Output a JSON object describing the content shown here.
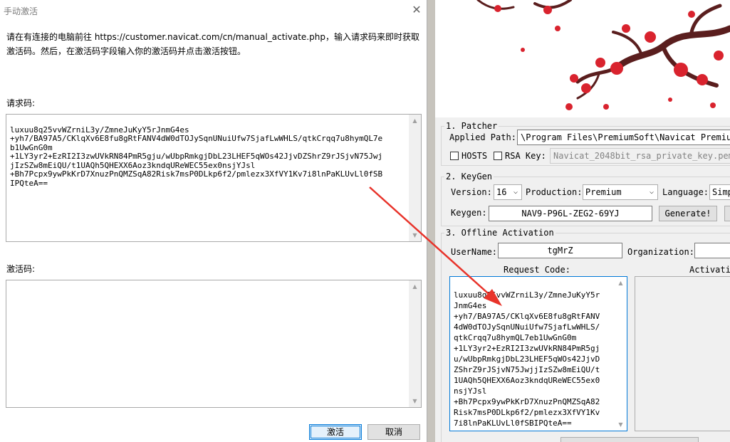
{
  "dialog": {
    "title": "手动激活",
    "instruction": "请在有连接的电脑前往 https://customer.navicat.com/cn/manual_activate.php，输入请求码来即时获取激活码。然后，在激活码字段输入你的激活码并点击激活按钮。",
    "request_label": "请求码:",
    "request_lines": [
      "luxuu8q25vvWZrniL3y/ZmneJuKyY5rJnmG4es",
      "+yh7/BA97A5/CKlqXv6E8fu8gRtFANV4dW0dTOJySqnUNuiUfw7SjafLwWHLS/qtkCrqq7u8hymQL7e",
      "b1UwGnG0m",
      "+1LY3yr2+EzRI2I3zwUVkRN84PmR5gju/wUbpRmkgjDbL23LHEF5qWOs42JjvDZShrZ9rJSjvN75Jwj",
      "jIzSZw8mEiQU/t1UAQh5QHEXX6Aoz3kndqUReWEC55ex0nsjYJsl",
      "+Bh7Pcpx9ywPkKrD7XnuzPnQMZSqA82Risk7msP0DLkp6f2/pmlezx3XfVY1Kv7i8lnPaKLUvLl0fSB",
      "IPQteA=="
    ],
    "activation_label": "激活码:",
    "activate_button": "激活",
    "cancel_button": "取消",
    "close_glyph": "✕"
  },
  "keygen": {
    "patcher": {
      "legend": "1. Patcher",
      "applied_path_label": "Applied Path:",
      "applied_path_value": "\\Program Files\\PremiumSoft\\Navicat Premium",
      "hosts_label": "HOSTS",
      "rsa_key_label": "RSA Key:",
      "rsa_key_value": "Navicat_2048bit_rsa_private_key.pem"
    },
    "keygen_section": {
      "legend": "2. KeyGen",
      "version_label": "Version:",
      "version_value": "16",
      "production_label": "Production:",
      "production_value": "Premium",
      "language_label": "Language:",
      "language_value": "Simp",
      "keygen_label": "Keygen:",
      "keygen_value": "NAV9-P96L-ZEG2-69YJ",
      "generate_button": "Generate!"
    },
    "offline": {
      "legend": "3. Offline Activation",
      "username_label": "UserName:",
      "username_value": "tgMrZ",
      "organization_label": "Organization:",
      "request_code_label": "Request Code:",
      "activation_label": "Activatio",
      "request_lines": [
        "luxuu8q25vvWZrniL3y/ZmneJuKyY5r",
        "JnmG4es",
        "+yh7/BA97A5/CKlqXv6E8fu8gRtFANV",
        "4dW0dTOJySqnUNuiUfw7SjafLwWHLS/",
        "qtkCrqq7u8hymQL7eb1UwGnG0m",
        "+1LY3yr2+EzRI2I3zwUVkRN84PmR5gj",
        "u/wUbpRmkgjDbL23LHEF5qWOs42JjvD",
        "ZShrZ9rJSjvN75JwjjIzSZw8mEiQU/t",
        "1UAQh5QHEXX6Aoz3kndqUReWEC55ex0",
        "nsjYJsl",
        "+Bh7Pcpx9ywPkKrD7XnuzPnQMZSqA82",
        "Risk7msP0DLkp6f2/pmlezx3XfVY1Kv",
        "7i8lnPaKLUvLl0fSBIPQteA=="
      ]
    }
  },
  "colors": {
    "accent": "#0078d7",
    "annotation_arrow": "#e8332a",
    "branch": "#5a1e1e",
    "blossom": "#d9232e"
  },
  "glyphs": {
    "arrow_up": "▲",
    "arrow_down": "▼",
    "combo_arrow": "⌵"
  }
}
